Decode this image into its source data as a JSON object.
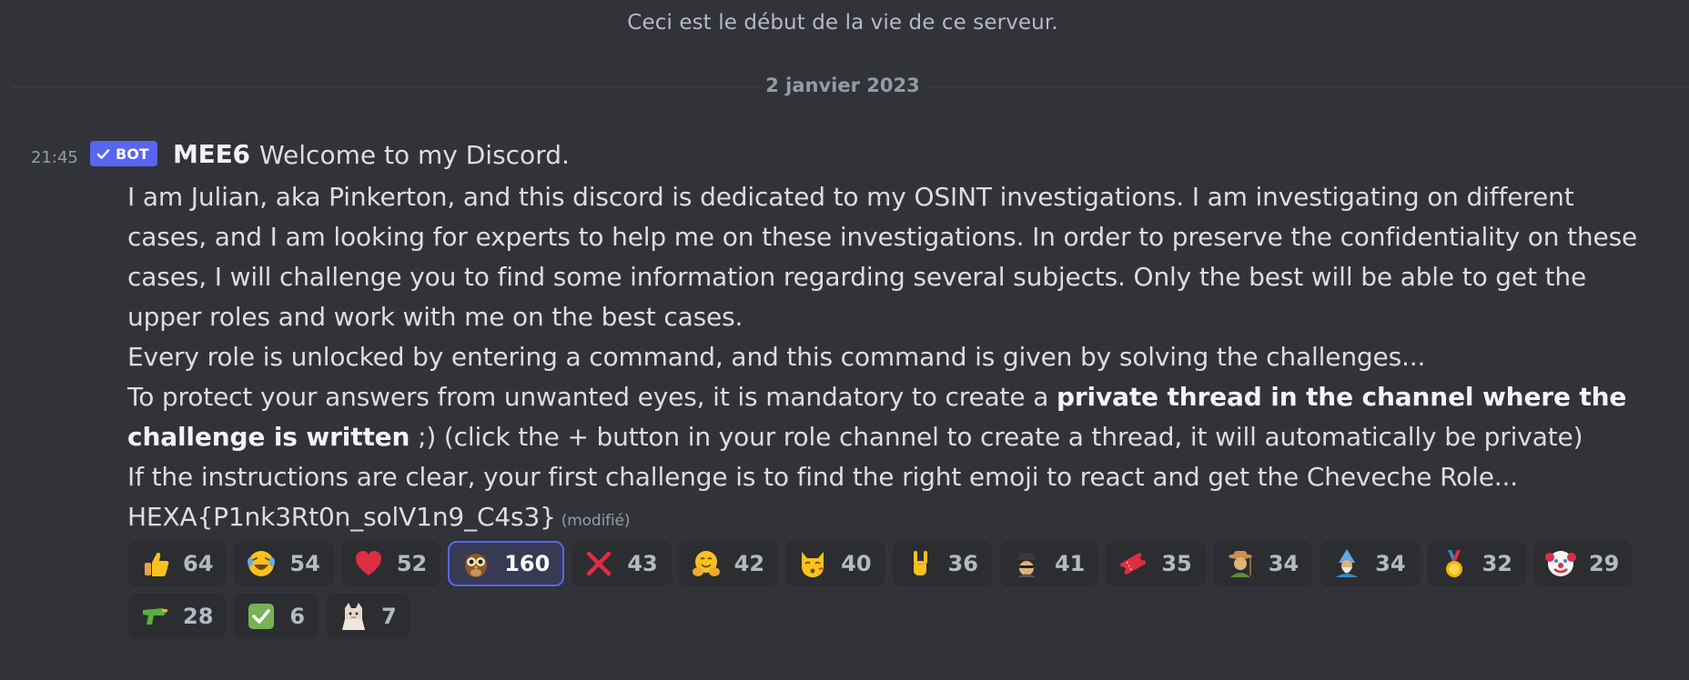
{
  "channel_intro": "Ceci est le début de la vie de ce serveur.",
  "date_divider": "2 janvier 2023",
  "message": {
    "timestamp": "21:45",
    "badge": "BOT",
    "author": "MEE6",
    "headline": "Welcome to my Discord.",
    "lines": {
      "l1": "I am Julian, aka Pinkerton, and this discord is dedicated to my OSINT investigations. I am investigating on different",
      "l2": "cases, and I am looking for experts to help me on these investigations. In order to preserve the confidentiality on these",
      "l3": "cases, I will challenge you to find some information regarding several subjects. Only the best will be able to get the",
      "l4": "upper roles and work with me on the best cases.",
      "l5": "Every role is unlocked by entering a command, and this command is given by solving the challenges...",
      "l6_start": "To protect your answers from unwanted eyes, it is mandatory to create a ",
      "l6_bold": "private thread in the channel where the",
      "l7_bold": "challenge is written",
      "l7_end": " ;) (click the + button in your role channel to create a thread, it will automatically be private)",
      "l8": "If the instructions are clear, your first challenge is to find the right emoji to react and get the Cheveche Role...",
      "l9": "HEXA{P1nk3Rt0n_solV1n9_C4s3}"
    },
    "edited_label": "(modifié)",
    "accent_color": "#5865f2"
  },
  "reactions": [
    {
      "icon": "thumbs-up-icon",
      "count": "64"
    },
    {
      "icon": "laughing-tears-icon",
      "count": "54"
    },
    {
      "icon": "red-heart-icon",
      "count": "52"
    },
    {
      "icon": "owl-icon",
      "count": "160",
      "selected": true
    },
    {
      "icon": "cross-mark-icon",
      "count": "43"
    },
    {
      "icon": "hugging-face-icon",
      "count": "42"
    },
    {
      "icon": "kissing-cat-icon",
      "count": "40"
    },
    {
      "icon": "rock-on-hand-icon",
      "count": "36"
    },
    {
      "icon": "detective-icon",
      "count": "41"
    },
    {
      "icon": "ticket-icon",
      "count": "35"
    },
    {
      "icon": "farmer-icon",
      "count": "34"
    },
    {
      "icon": "mage-icon",
      "count": "34"
    },
    {
      "icon": "gold-medal-icon",
      "count": "32"
    },
    {
      "icon": "clown-face-icon",
      "count": "29"
    },
    {
      "icon": "water-pistol-icon",
      "count": "28"
    },
    {
      "icon": "check-mark-button-icon",
      "count": "6"
    },
    {
      "icon": "cat-meme-icon",
      "count": "7"
    }
  ]
}
